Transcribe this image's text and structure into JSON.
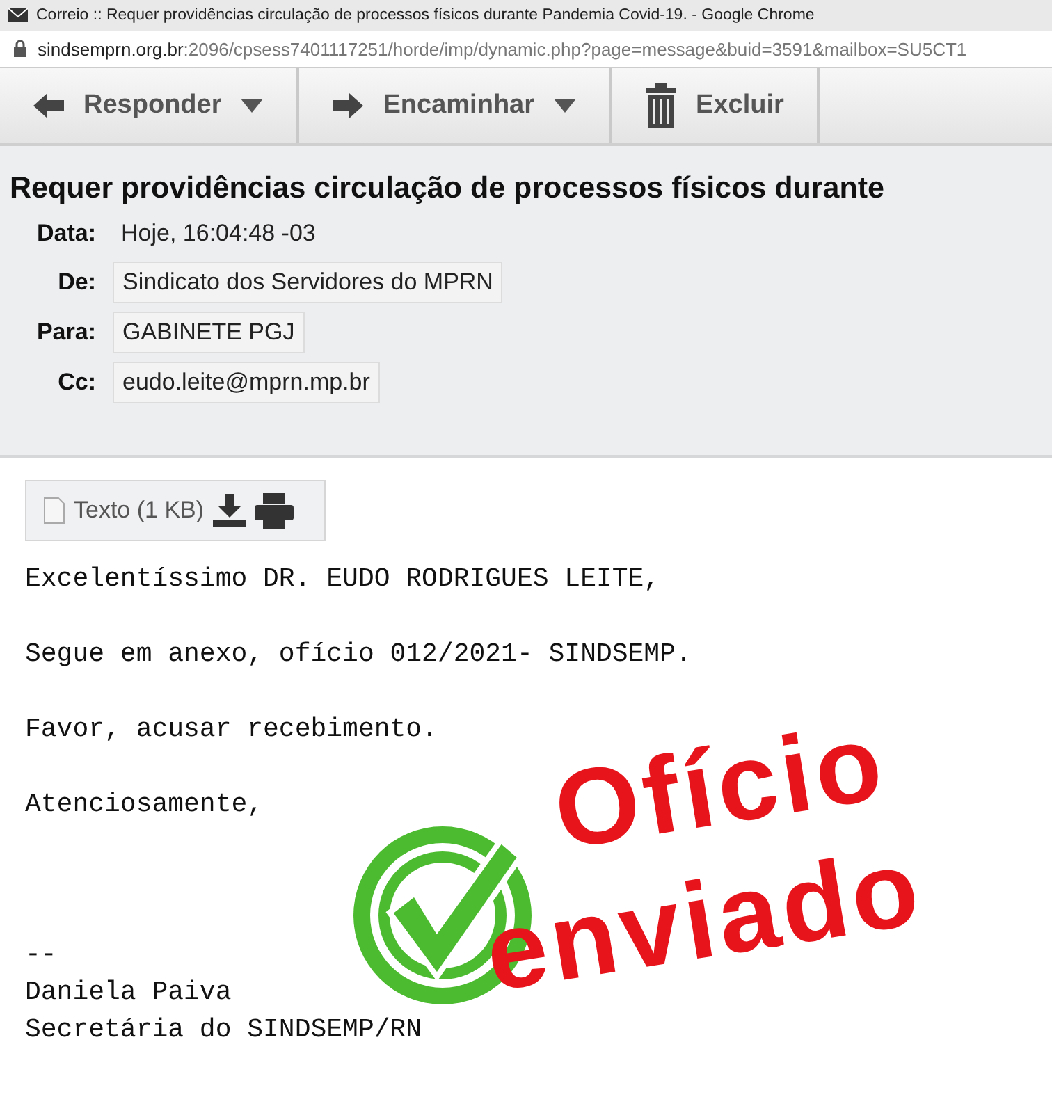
{
  "window": {
    "title": "Correio :: Requer providências circulação de processos físicos durante Pandemia Covid-19. - Google Chrome"
  },
  "address_bar": {
    "host": "sindsemprn.org.br",
    "path": ":2096/cpsess7401117251/horde/imp/dynamic.php?page=message&buid=3591&mailbox=SU5CT1"
  },
  "toolbar": {
    "buttons": [
      {
        "label": "Responder",
        "kind": "reply",
        "has_menu": true
      },
      {
        "label": "Encaminhar",
        "kind": "forward",
        "has_menu": true
      },
      {
        "label": "Excluir",
        "kind": "delete",
        "has_menu": false
      }
    ]
  },
  "message": {
    "subject": "Requer providências circulação de processos físicos durante",
    "headers": [
      {
        "label": "Data:",
        "value": "Hoje, 16:04:48 -03",
        "kind": "plain"
      },
      {
        "label": "De:",
        "value": "Sindicato dos Servidores do MPRN",
        "kind": "chip"
      },
      {
        "label": "Para:",
        "value": "GABINETE PGJ",
        "kind": "chip"
      },
      {
        "label": "Cc:",
        "value": "eudo.leite@mprn.mp.br",
        "kind": "chip"
      }
    ],
    "attachment": {
      "label": "Texto (1 KB)"
    },
    "paragraphs": [
      "Excelentíssimo DR. EUDO RODRIGUES LEITE,",
      "Segue em anexo, ofício 012/2021- SINDSEMP.",
      "Favor, acusar recebimento.",
      "Atenciosamente,"
    ],
    "signature": [
      "--",
      "Daniela Paiva",
      "Secretária do SINDSEMP/RN"
    ]
  },
  "stamp": {
    "lines": [
      "Ofício",
      "enviado"
    ]
  }
}
